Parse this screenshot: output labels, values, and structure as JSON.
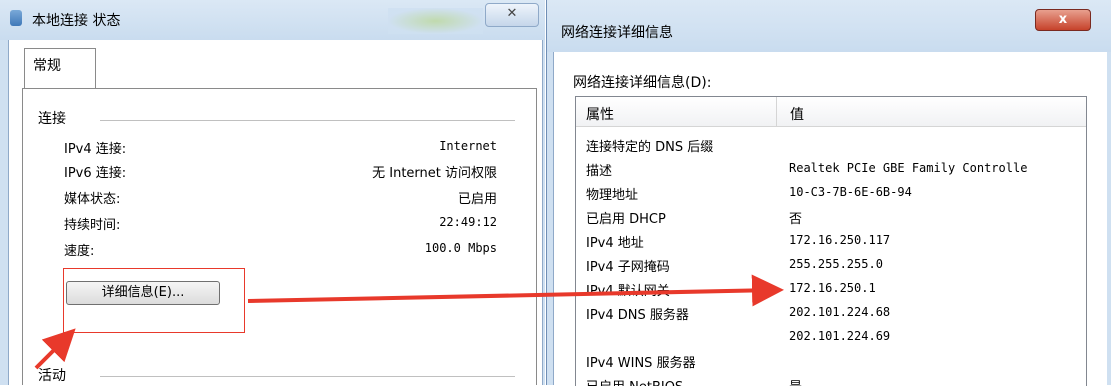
{
  "left_window": {
    "title": "本地连接 状态",
    "close_glyph": "✕",
    "tab_general": "常规",
    "group_connection": "连接",
    "rows": [
      {
        "label": "IPv4 连接:",
        "value": "Internet"
      },
      {
        "label": "IPv6 连接:",
        "value": "无 Internet 访问权限"
      },
      {
        "label": "媒体状态:",
        "value": "已启用"
      },
      {
        "label": "持续时间:",
        "value": "22:49:12"
      },
      {
        "label": "速度:",
        "value": "100.0 Mbps"
      }
    ],
    "details_button": "详细信息(E)...",
    "group_activity": "活动"
  },
  "right_window": {
    "title": "网络连接详细信息",
    "close_glyph": "x",
    "list_label": "网络连接详细信息(D):",
    "col_property": "属性",
    "col_value": "值",
    "rows": [
      {
        "prop": "连接特定的 DNS 后缀",
        "value": ""
      },
      {
        "prop": "描述",
        "value": "Realtek PCIe GBE Family Controlle"
      },
      {
        "prop": "物理地址",
        "value": "10-C3-7B-6E-6B-94"
      },
      {
        "prop": "已启用 DHCP",
        "value": "否"
      },
      {
        "prop": "IPv4 地址",
        "value": "172.16.250.117"
      },
      {
        "prop": "IPv4 子网掩码",
        "value": "255.255.255.0"
      },
      {
        "prop": "IPv4 默认网关",
        "value": "172.16.250.1"
      },
      {
        "prop": "IPv4 DNS 服务器",
        "value": "202.101.224.68"
      },
      {
        "prop": "",
        "value": "202.101.224.69"
      },
      {
        "prop": "IPv4 WINS 服务器",
        "value": ""
      },
      {
        "prop": "已启用 NetBIOS",
        "value": "是"
      }
    ]
  },
  "annotation": {
    "color": "#e8392b"
  }
}
